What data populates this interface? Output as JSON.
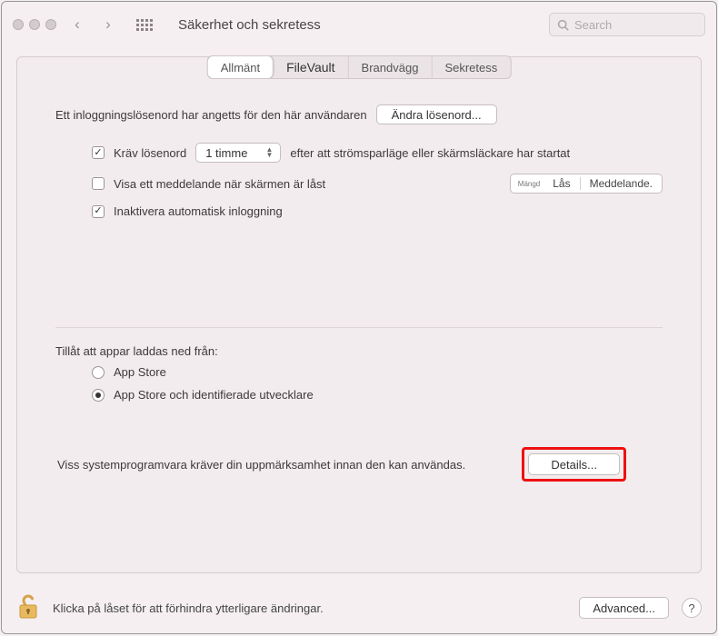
{
  "window": {
    "title": "Säkerhet och sekretess",
    "search_placeholder": "Search"
  },
  "tabs": [
    "Allmänt",
    "FileVault",
    "Brandvägg",
    "Sekretess"
  ],
  "general": {
    "intro_text": "Ett inloggningslösenord har angetts för den här användaren",
    "change_password_label": "Ändra lösenord...",
    "require_password": {
      "label_before": "Kräv lösenord",
      "popup_value": "1 timme",
      "label_after": "efter att strömsparläge eller skärmsläckare har startat",
      "checked": true
    },
    "show_message": {
      "label": "Visa ett meddelande när skärmen är låst",
      "checked": false,
      "group_tiny": "Mängd",
      "group_labels": [
        "Lås",
        "Meddelande."
      ]
    },
    "disable_autologin": {
      "label": "Inaktivera automatisk inloggning",
      "checked": true
    }
  },
  "download": {
    "heading": "Tillåt att appar laddas ned från:",
    "options": [
      {
        "label": "App Store",
        "selected": false
      },
      {
        "label": "App Store och identifierade utvecklare",
        "selected": true
      }
    ]
  },
  "attention": {
    "text": "Viss systemprogramvara kräver din uppmärksamhet innan den kan användas.",
    "button": "Details..."
  },
  "footer": {
    "lock_text": "Klicka på låset för att förhindra ytterligare ändringar.",
    "advanced_label": "Advanced...",
    "help_label": "?"
  }
}
